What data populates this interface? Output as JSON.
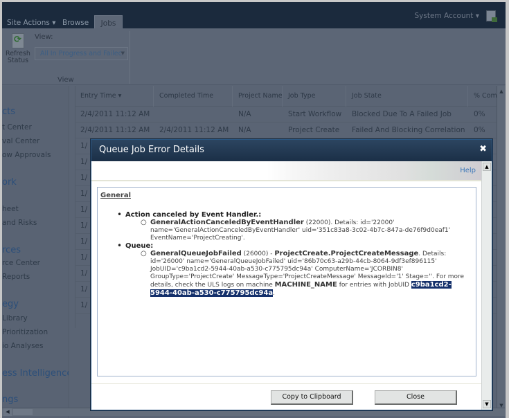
{
  "ribbon": {
    "tabs": [
      {
        "label": "Site Actions ▾"
      },
      {
        "label": "Browse"
      },
      {
        "label": "Jobs"
      }
    ],
    "account": "System Account ▾",
    "refresh_label_1": "Refresh",
    "refresh_label_2": "Status",
    "view_label": "View:",
    "view_select_value": "All In Progress and Failec",
    "group_label": "View"
  },
  "leftnav": {
    "items": [
      {
        "label": "cts",
        "head": true
      },
      {
        "label": "t Center"
      },
      {
        "label": "val Center"
      },
      {
        "label": "ow Approvals"
      },
      {
        "label": "ork",
        "head": true
      },
      {
        "label": "heet"
      },
      {
        "label": " and Risks"
      },
      {
        "label": "rces",
        "head": true
      },
      {
        "label": "rce Center"
      },
      {
        "label": " Reports"
      },
      {
        "label": "egy",
        "head": true
      },
      {
        "label": " Library"
      },
      {
        "label": " Prioritization"
      },
      {
        "label": "io Analyses"
      },
      {
        "label": "ess Intelligence",
        "head": true
      },
      {
        "label": "ngs",
        "head": true
      }
    ]
  },
  "grid": {
    "columns": [
      "Entry Time ▾",
      "Completed Time",
      "Project Name",
      "Job Type",
      "Job State",
      "% Comp"
    ],
    "rows": [
      [
        "2/4/2011 11:12 AM",
        "",
        "N/A",
        "Start Workflow",
        "Blocked Due To A Failed Job",
        "0%"
      ],
      [
        "2/4/2011 11:12 AM",
        "2/4/2011 11:12 AM",
        "N/A",
        "Project Create",
        "Failed And Blocking Correlation",
        "0%"
      ],
      [
        "1/",
        "",
        "",
        "",
        "",
        ""
      ],
      [
        "1/",
        "",
        "",
        "",
        "",
        ""
      ],
      [
        "1/",
        "",
        "",
        "",
        "",
        ""
      ],
      [
        "1/",
        "",
        "",
        "",
        "",
        ""
      ],
      [
        "1/",
        "",
        "",
        "",
        "",
        ""
      ],
      [
        "1/",
        "",
        "",
        "",
        "",
        ""
      ],
      [
        "1/",
        "",
        "",
        "",
        "",
        ""
      ],
      [
        "1/",
        "",
        "",
        "",
        "",
        ""
      ],
      [
        "1/",
        "",
        "",
        "",
        "",
        ""
      ],
      [
        "1/",
        "",
        "",
        "",
        "",
        ""
      ],
      [
        "1/",
        "",
        "",
        "",
        "",
        ""
      ]
    ]
  },
  "modal": {
    "title": "Queue Job Error Details",
    "close_glyph": "✖",
    "help_label": "Help",
    "section_label": "General",
    "errors": [
      {
        "title": "Action canceled by Event Handler.:",
        "detail_name": "GeneralActionCanceledByEventHandler",
        "detail_text": " (22000). Details: id='22000' name='GeneralActionCanceledByEventHandler' uid='351c83a8-3c02-4b7c-847a-de76f9d0eaf1' EventName='ProjectCreating'."
      },
      {
        "title": "Queue:",
        "detail_name": "GeneralQueueJobFailed",
        "detail_code": " (26000) - ",
        "detail_message": "ProjectCreate.ProjectCreateMessage",
        "detail_text": ". Details: id='26000' name='GeneralQueueJobFailed' uid='86b70c63-a29b-44cb-8064-9df3ef896115' JobUID='c9ba1cd2-5944-40ab-a530-c775795dc94a' ComputerName='JCORBIN8' GroupType='ProjectCreate' MessageType='ProjectCreateMessage' MessageId='1' Stage=''. For more details, check the ULS logs on machine ",
        "machine_name": "MACHINE_NAME",
        "detail_text_2": " for entries with JobUID ",
        "selected_job_uid": "c9ba1cd2-5944-40ab-a530-c775795dc94a",
        "trailing": "."
      }
    ],
    "copy_button": "Copy to Clipboard",
    "close_button": "Close"
  }
}
